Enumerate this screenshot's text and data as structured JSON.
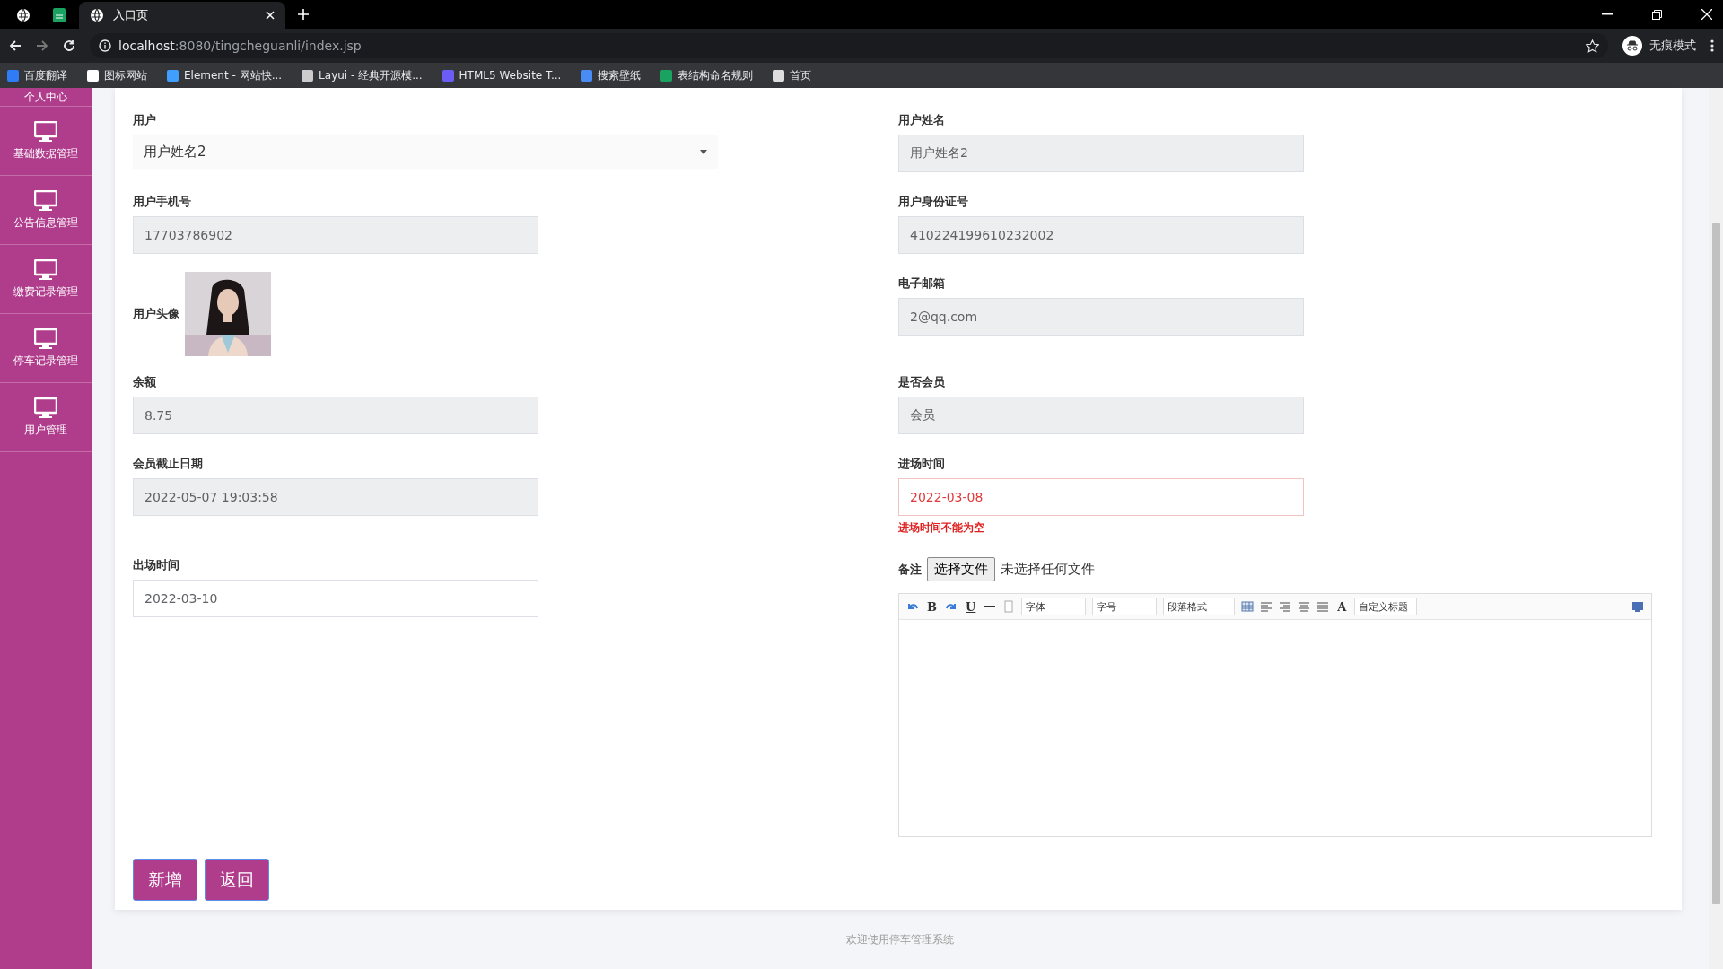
{
  "browser": {
    "tabs": [
      {
        "title": "入口页",
        "selected": true
      }
    ],
    "url_host": "localhost",
    "url_rest": ":8080/tingcheguanli/index.jsp",
    "profile": "无痕模式",
    "bookmarks": [
      {
        "label": "百度翻译",
        "color": "#2f7cf6"
      },
      {
        "label": "图标网站",
        "color": "#ffffff"
      },
      {
        "label": "Element - 网站快...",
        "color": "#409eff"
      },
      {
        "label": "Layui - 经典开源模...",
        "color": "#cccccc"
      },
      {
        "label": "HTML5 Website T...",
        "color": "#6b5cf6"
      },
      {
        "label": "搜索壁纸",
        "color": "#4a8cf6"
      },
      {
        "label": "表结构命名规则",
        "color": "#1aa260"
      },
      {
        "label": "首页",
        "color": "#dddddd"
      }
    ]
  },
  "sidebar": {
    "items": [
      {
        "label": "个人中心"
      },
      {
        "label": "基础数据管理"
      },
      {
        "label": "公告信息管理"
      },
      {
        "label": "缴费记录管理"
      },
      {
        "label": "停车记录管理"
      },
      {
        "label": "用户管理"
      }
    ]
  },
  "form": {
    "left": [
      {
        "kind": "select",
        "label": "用户",
        "value": "用户姓名2"
      },
      {
        "kind": "input",
        "label": "用户手机号",
        "value": "17703786902",
        "disabled": true
      },
      {
        "label": "用户头像"
      },
      {
        "kind": "input",
        "label": "余额",
        "value": "8.75",
        "disabled": true
      },
      {
        "kind": "input",
        "label": "会员截止日期",
        "value": "2022-05-07 19:03:58",
        "disabled": true
      },
      {
        "kind": "input",
        "label": "出场时间",
        "value": "2022-03-10",
        "disabled": false
      }
    ],
    "right": [
      {
        "kind": "input",
        "label": "用户姓名",
        "value": "用户姓名2",
        "disabled": true
      },
      {
        "kind": "input",
        "label": "用户身份证号",
        "value": "410224199610232002",
        "disabled": true
      },
      {
        "kind": "input",
        "label": "电子邮箱",
        "value": "2@qq.com",
        "disabled": true
      },
      {
        "kind": "input",
        "label": "是否会员",
        "value": "会员",
        "disabled": true
      },
      {
        "kind": "input",
        "label": "进场时间",
        "value": "2022-03-08",
        "disabled": false,
        "error": "进场时间不能为空"
      },
      {
        "kind": "editor",
        "label": "备注",
        "file_button": "选择文件",
        "file_status": "未选择任何文件",
        "bold": "B",
        "underline": "U",
        "font": "字体",
        "size": "字号",
        "format": "段落格式",
        "color_button": "A",
        "heading": "自定义标题"
      }
    ]
  },
  "buttons": [
    "新增",
    "返回"
  ],
  "footer": "欢迎使用停车管理系统"
}
